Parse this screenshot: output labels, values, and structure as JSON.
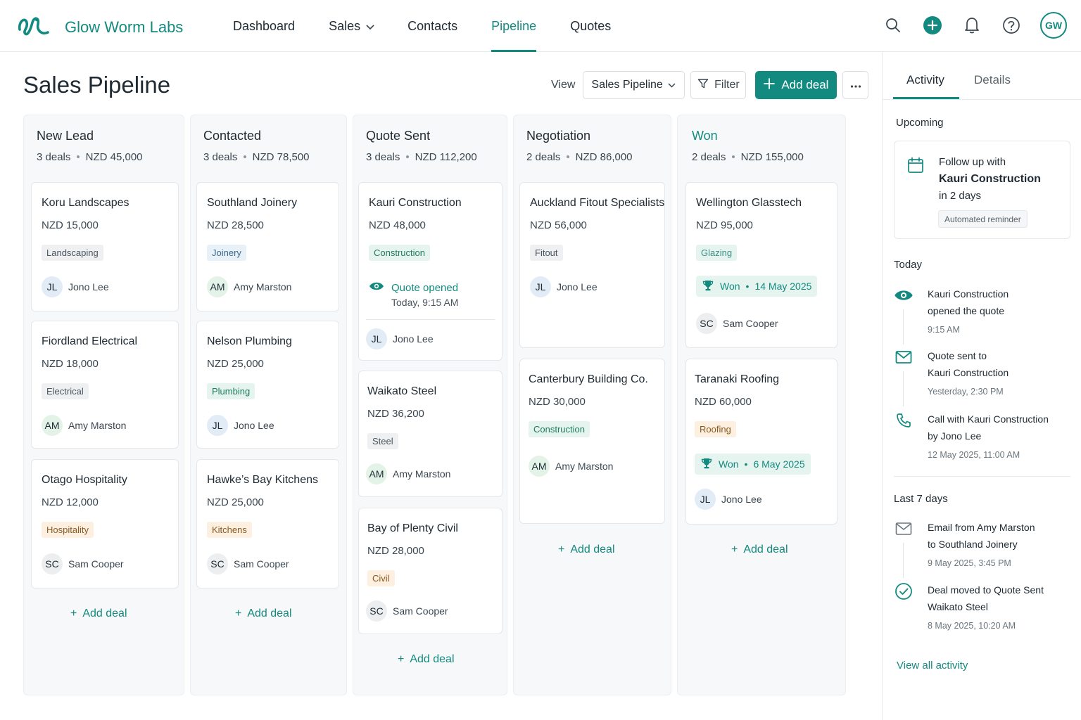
{
  "brand": {
    "name": "Glow Worm Labs",
    "accent": "#138a80"
  },
  "nav": [
    {
      "label": "Dashboard"
    },
    {
      "label": "Sales"
    },
    {
      "label": "Contacts"
    },
    {
      "label": "Pipeline"
    },
    {
      "label": "Quotes"
    }
  ],
  "user": {
    "initials": "GW"
  },
  "page": {
    "title": "Sales Pipeline",
    "view_label": "View",
    "view_selected": "Sales Pipeline",
    "filter_label": "Filter",
    "add_deal_label": "Add deal",
    "add_deal_link": "Add deal"
  },
  "columns": [
    {
      "title": "New Lead",
      "count": "3 deals",
      "total": "NZD 45,000",
      "cards": [
        {
          "name": "Koru Landscapes",
          "amount": "NZD 15,000",
          "tag": "Landscaping",
          "owner_initials": "JL",
          "owner": "Jono Lee"
        },
        {
          "name": "Fiordland Electrical",
          "amount": "NZD 18,000",
          "tag": "Electrical",
          "owner_initials": "AM",
          "owner": "Amy Marston"
        },
        {
          "name": "Otago Hospitality",
          "amount": "NZD 12,000",
          "tag": "Hospitality",
          "owner_initials": "SC",
          "owner": "Sam Cooper"
        }
      ]
    },
    {
      "title": "Contacted",
      "count": "3 deals",
      "total": "NZD 78,500",
      "cards": [
        {
          "name": "Southland Joinery",
          "amount": "NZD 28,500",
          "tag": "Joinery",
          "owner_initials": "AM",
          "owner": "Amy Marston"
        },
        {
          "name": "Nelson Plumbing",
          "amount": "NZD 25,000",
          "tag": "Plumbing",
          "owner_initials": "JL",
          "owner": "Jono Lee"
        },
        {
          "name": "Hawke’s Bay Kitchens",
          "amount": "NZD 25,000",
          "tag": "Kitchens",
          "owner_initials": "SC",
          "owner": "Sam Cooper"
        }
      ]
    },
    {
      "title": "Quote Sent",
      "count": "3 deals",
      "total": "NZD 112,200",
      "cards": [
        {
          "name": "Kauri Construction",
          "amount": "NZD 48,000",
          "tag": "Construction",
          "status": "Quote opened",
          "status_time": "Today, 9:15 AM",
          "owner_initials": "JL",
          "owner": "Jono Lee"
        },
        {
          "name": "Waikato Steel",
          "amount": "NZD 36,200",
          "tag": "Steel",
          "owner_initials": "AM",
          "owner": "Amy Marston"
        },
        {
          "name": "Bay of Plenty Civil",
          "amount": "NZD 28,000",
          "tag": "Civil",
          "owner_initials": "SC",
          "owner": "Sam Cooper"
        }
      ]
    },
    {
      "title": "Negotiation",
      "count": "2 deals",
      "total": "NZD 86,000",
      "cards": [
        {
          "name": "Auckland Fitout Specialists",
          "amount": "NZD 56,000",
          "tag": "Fitout",
          "owner_initials": "JL",
          "owner": "Jono Lee"
        },
        {
          "name": "Canterbury Building Co.",
          "amount": "NZD 30,000",
          "tag": "Construction",
          "owner_initials": "AM",
          "owner": "Amy Marston"
        }
      ]
    },
    {
      "title": "Won",
      "count": "2 deals",
      "total": "NZD 155,000",
      "cards": [
        {
          "name": "Wellington Glasstech",
          "amount": "NZD 95,000",
          "tag": "Glazing",
          "won_label": "Won",
          "won_date": "14 May 2025",
          "owner_initials": "SC",
          "owner": "Sam Cooper"
        },
        {
          "name": "Taranaki Roofing",
          "amount": "NZD 60,000",
          "tag": "Roofing",
          "won_label": "Won",
          "won_date": "6 May 2025",
          "owner_initials": "JL",
          "owner": "Jono Lee"
        }
      ]
    }
  ],
  "side_panel": {
    "tabs": [
      "Activity",
      "Details"
    ],
    "upcoming_heading": "Upcoming",
    "upcoming": {
      "line1": "Follow up with",
      "line2": "Kauri Construction",
      "line3": "in 2 days",
      "chip": "Automated reminder"
    },
    "today_heading": "Today",
    "today": [
      {
        "icon": "eye-icon",
        "line1": "Kauri Construction",
        "line2": "opened the quote",
        "time": "9:15 AM"
      },
      {
        "icon": "mail-icon",
        "line1": "Quote sent to",
        "line2": "Kauri Construction",
        "time": "Yesterday, 2:30 PM"
      },
      {
        "icon": "phone-icon",
        "line1": "Call with Kauri Construction",
        "line2": "by Jono Lee",
        "time": "12 May 2025, 11:00 AM"
      }
    ],
    "last7_heading": "Last 7 days",
    "last7": [
      {
        "icon": "mail-icon",
        "line1": "Email from Amy Marston",
        "line2": "to Southland Joinery",
        "time": "9 May 2025, 3:45 PM"
      },
      {
        "icon": "check-circle-icon",
        "line1": "Deal moved to Quote Sent",
        "line2": "Waikato Steel",
        "time": "8 May 2025, 10:20 AM"
      }
    ],
    "view_all": "View all activity"
  }
}
